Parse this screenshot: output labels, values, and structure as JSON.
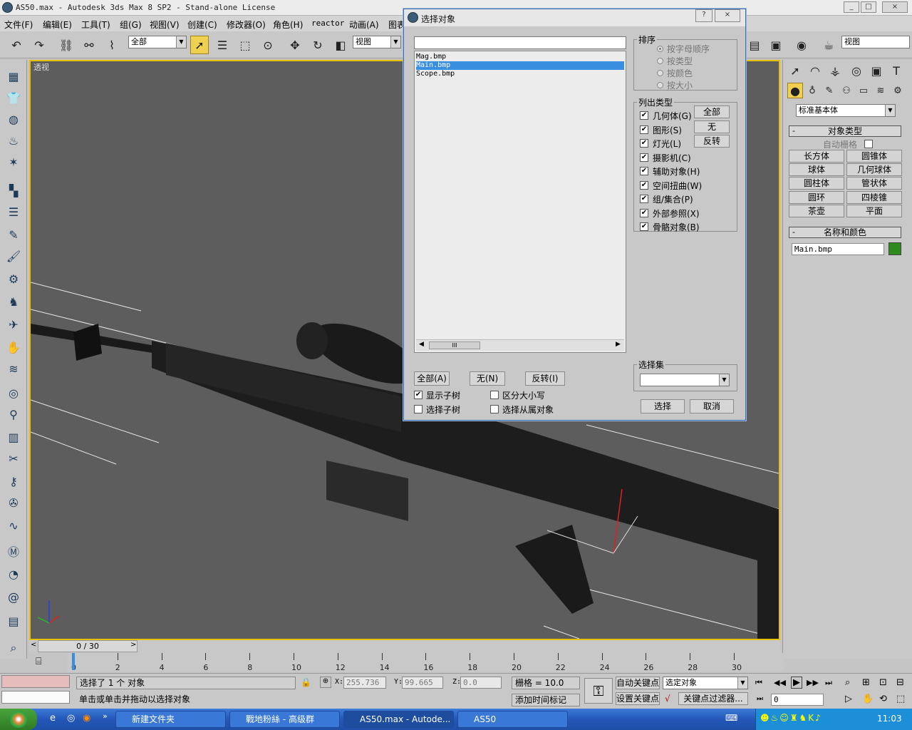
{
  "window": {
    "title": "AS50.max  - Autodesk 3ds Max 8 SP2  - Stand-alone License",
    "controls": [
      "_",
      "□",
      "×"
    ]
  },
  "menu": [
    "文件(F)",
    "编辑(E)",
    "工具(T)",
    "组(G)",
    "视图(V)",
    "创建(C)",
    "修改器(O)",
    "角色(H)",
    "reactor",
    "动画(A)",
    "图表"
  ],
  "toolbar": {
    "filter_combo": "全部",
    "ref_coord_combo": "视图",
    "named_sel_combo": "视图"
  },
  "viewport": {
    "label": "透视"
  },
  "dialog": {
    "title": "选择对象",
    "search_value": "",
    "objects": [
      "Mag.bmp",
      "Main.bmp",
      "Scope.bmp"
    ],
    "selected_index": 1,
    "sort": {
      "label": "排序",
      "options": [
        "按字母顺序",
        "按类型",
        "按颜色",
        "按大小"
      ],
      "selected": 0
    },
    "list_types": {
      "label": "列出类型",
      "items": [
        "几何体(G)",
        "图形(S)",
        "灯光(L)",
        "摄影机(C)",
        "辅助对象(H)",
        "空间扭曲(W)",
        "组/集合(P)",
        "外部参照(X)",
        "骨骼对象(B)"
      ],
      "buttons": [
        "全部",
        "无",
        "反转"
      ]
    },
    "bottom_buttons": [
      "全部(A)",
      "无(N)",
      "反转(I)"
    ],
    "checkboxes": [
      {
        "label": "显示子树",
        "checked": true
      },
      {
        "label": "区分大小写",
        "checked": false
      },
      {
        "label": "选择子树",
        "checked": false
      },
      {
        "label": "选择从属对象",
        "checked": false
      }
    ],
    "selection_set": {
      "label": "选择集",
      "value": ""
    },
    "select_button": "选择",
    "cancel_button": "取消",
    "help_button": "?",
    "close_button": "×"
  },
  "cmdpanel": {
    "category_combo": "标准基本体",
    "object_type": {
      "header": "对象类型",
      "autogrid": "自动栅格",
      "buttons": [
        "长方体",
        "圆锥体",
        "球体",
        "几何球体",
        "圆柱体",
        "管状体",
        "圆环",
        "四棱锥",
        "茶壶",
        "平面"
      ]
    },
    "name_color": {
      "header": "名称和颜色",
      "name": "Main.bmp",
      "color": "#2f8a1e"
    }
  },
  "timeline": {
    "frame_indicator": "0 / 30",
    "ticks": [
      "0",
      "2",
      "4",
      "6",
      "8",
      "10",
      "12",
      "14",
      "16",
      "18",
      "20",
      "22",
      "24",
      "26",
      "28",
      "30"
    ]
  },
  "status": {
    "selection_text": "选择了 1 个 对象",
    "prompt_text": "单击或单击并拖动以选择对象",
    "x_label": "X:",
    "x_value": "255.736",
    "y_label": "Y:",
    "y_value": "99.665",
    "z_label": "Z:",
    "z_value": "0.0",
    "grid_text": "栅格 = 10.0",
    "add_time_tag": "添加时间标记",
    "auto_key": "自动关键点",
    "set_key": "设置关键点",
    "key_mode_combo": "选定对象",
    "key_filters": "关键点过滤器...",
    "frame_field": "0"
  },
  "taskbar": {
    "tasks": [
      "新建文件夹",
      "戰地粉絲 - 高级群",
      "AS50.max - Autode...",
      "AS50"
    ],
    "active_index": 2,
    "clock": "11:03"
  },
  "colors": {
    "selection": "#3a8ee0",
    "viewport_border": "#e8c000",
    "viewport_bg": "#5d5d5d"
  }
}
